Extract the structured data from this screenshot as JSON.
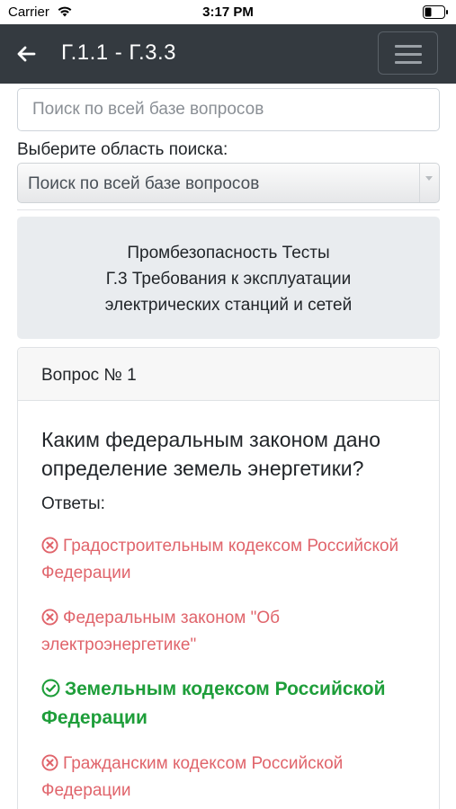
{
  "status_bar": {
    "carrier": "Carrier",
    "time": "3:17 PM"
  },
  "navbar": {
    "title": "Г.1.1 - Г.3.3"
  },
  "search": {
    "placeholder": "Поиск по всей базе вопросов",
    "area_label": "Выберите область поиска:",
    "area_selected": "Поиск по всей базе вопросов"
  },
  "info": {
    "line1": "Промбезопасность Тесты",
    "line2": "Г.3 Требования к эксплуатации",
    "line3": "электрических станций и сетей"
  },
  "question_card": {
    "header": "Вопрос № 1",
    "question_line1": "Каким федеральным законом дано",
    "question_line2": "определение земель энергетики?",
    "answers_label": "Ответы:",
    "answers": [
      {
        "line1": "Градостроительным кодексом Российской",
        "line2": "Федерации",
        "correct": false
      },
      {
        "line1": "Федеральным законом \"Об",
        "line2": "электроэнергетике\"",
        "correct": false
      },
      {
        "line1": "Земельным кодексом Российской",
        "line2": "Федерации",
        "correct": true
      },
      {
        "line1": "Гражданским кодексом Российской",
        "line2": "Федерации",
        "correct": false
      }
    ]
  },
  "colors": {
    "navbar_bg": "#343a40",
    "wrong": "#e0646b",
    "correct": "#1e9e3a",
    "info_bg": "#e9ecef"
  },
  "icons": {
    "back": "arrow-left-icon",
    "menu": "hamburger-menu-icon",
    "wrong": "x-circle-icon",
    "correct": "check-circle-icon"
  }
}
